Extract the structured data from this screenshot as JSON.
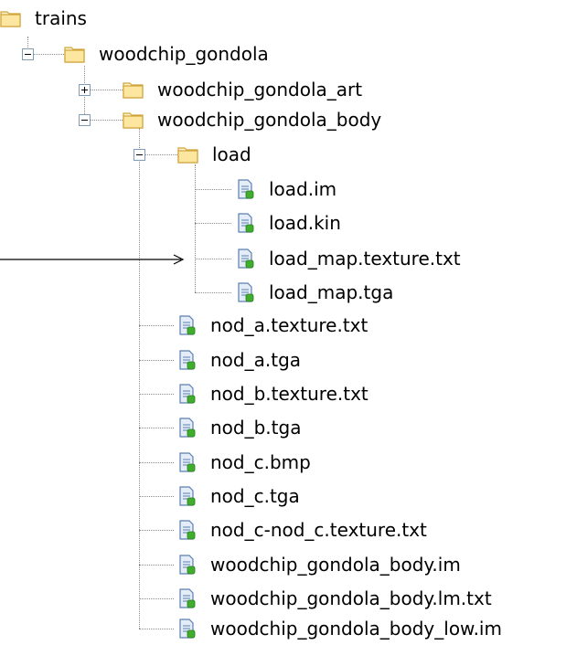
{
  "tree": {
    "root": {
      "label": "trains",
      "icon": "folder-icon"
    },
    "gondola": {
      "label": "woodchip_gondola",
      "icon": "folder-icon",
      "state": "expanded"
    },
    "art": {
      "label": "woodchip_gondola_art",
      "icon": "folder-icon",
      "state": "collapsed"
    },
    "body": {
      "label": "woodchip_gondola_body",
      "icon": "folder-icon",
      "state": "expanded"
    },
    "load": {
      "label": "load",
      "icon": "folder-icon",
      "state": "expanded"
    },
    "load_files": [
      {
        "label": "load.im",
        "icon": "file-icon"
      },
      {
        "label": "load.kin",
        "icon": "file-icon"
      },
      {
        "label": "load_map.texture.txt",
        "icon": "file-icon"
      },
      {
        "label": "load_map.tga",
        "icon": "file-icon"
      }
    ],
    "body_files": [
      {
        "label": "nod_a.texture.txt",
        "icon": "file-icon"
      },
      {
        "label": "nod_a.tga",
        "icon": "file-icon"
      },
      {
        "label": "nod_b.texture.txt",
        "icon": "file-icon"
      },
      {
        "label": "nod_b.tga",
        "icon": "file-icon"
      },
      {
        "label": "nod_c.bmp",
        "icon": "file-icon"
      },
      {
        "label": "nod_c.tga",
        "icon": "file-icon"
      },
      {
        "label": "nod_c-nod_c.texture.txt",
        "icon": "file-icon"
      },
      {
        "label": "woodchip_gondola_body.im",
        "icon": "file-icon"
      },
      {
        "label": "woodchip_gondola_body.lm.txt",
        "icon": "file-icon"
      },
      {
        "label": "woodchip_gondola_body_low.im",
        "icon": "file-icon"
      }
    ]
  },
  "colors": {
    "folder_fill": "#fde7a0",
    "folder_edge": "#d0a33a",
    "file_fill": "#e4ecf7",
    "file_edge": "#5a7fb0",
    "file_badge": "#3fae2c",
    "dotted_line": "#8a8a8a",
    "expander_border": "#7f9db9"
  }
}
